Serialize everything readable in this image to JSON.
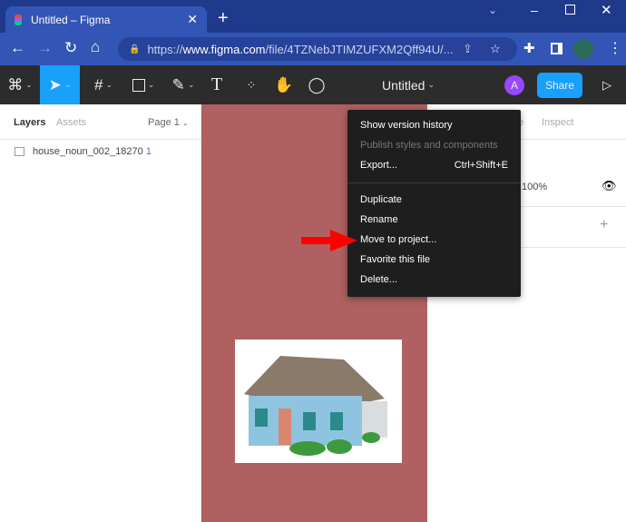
{
  "browser": {
    "tab_title": "Untitled – Figma",
    "url_prefix": "https://",
    "url_host": "www.figma.com",
    "url_path": "/file/4TZNebJTIMZUFXM2Qff94U/..."
  },
  "toolbar": {
    "file_title": "Untitled",
    "avatar_letter": "A",
    "share_label": "Share"
  },
  "left_panel": {
    "tabs": [
      "Layers",
      "Assets"
    ],
    "page": "Page 1",
    "layers": [
      {
        "name": "house_noun_002_18270",
        "suffix": "1"
      }
    ]
  },
  "right_panel": {
    "tab_partial": "be",
    "tab_inspect": "Inspect",
    "opacity": "100%"
  },
  "menu": {
    "items": [
      {
        "label": "Show version history",
        "shortcut": "",
        "disabled": false
      },
      {
        "label": "Publish styles and components",
        "shortcut": "",
        "disabled": true
      },
      {
        "label": "Export...",
        "shortcut": "Ctrl+Shift+E",
        "disabled": false
      },
      {
        "label": "Duplicate",
        "shortcut": "",
        "disabled": false
      },
      {
        "label": "Rename",
        "shortcut": "",
        "disabled": false
      },
      {
        "label": "Move to project...",
        "shortcut": "",
        "disabled": false
      },
      {
        "label": "Favorite this file",
        "shortcut": "",
        "disabled": false
      },
      {
        "label": "Delete...",
        "shortcut": "",
        "disabled": false
      }
    ]
  },
  "colors": {
    "accent": "#18a0fb",
    "canvas": "#b06060",
    "avatar": "#9747ff",
    "arrow": "#ff0000"
  }
}
